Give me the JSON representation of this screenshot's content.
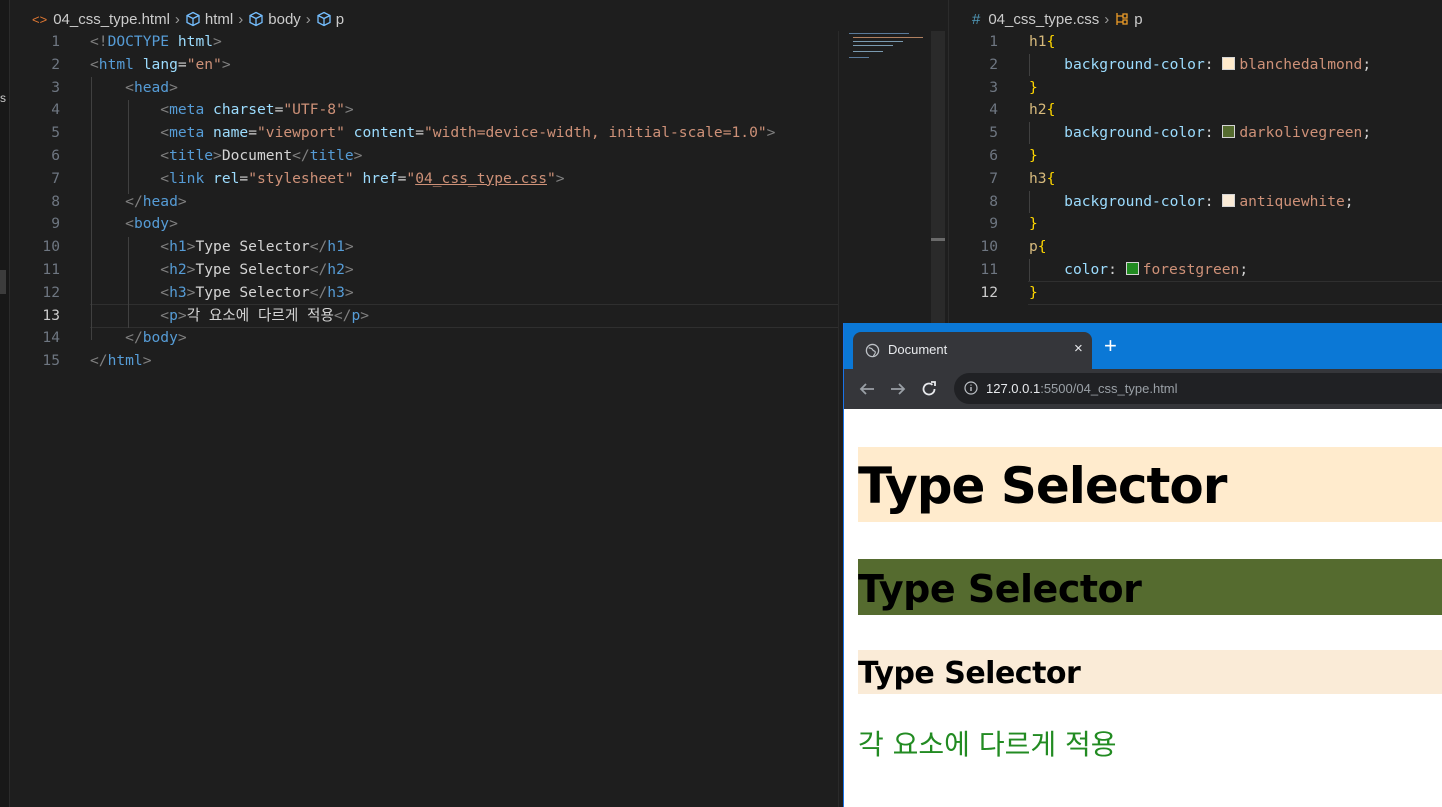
{
  "html_editor": {
    "breadcrumb": {
      "file": "04_css_type.html",
      "html": "html",
      "body": "body",
      "p": "p"
    },
    "lines": [
      {
        "n": "1",
        "segs": [
          [
            "t-br",
            "<!"
          ],
          [
            "t-tag",
            "DOCTYPE"
          ],
          [
            "t-txt",
            " "
          ],
          [
            "t-attr",
            "html"
          ],
          [
            "t-br",
            ">"
          ]
        ]
      },
      {
        "n": "2",
        "segs": [
          [
            "t-br",
            "<"
          ],
          [
            "t-tag",
            "html"
          ],
          [
            "t-txt",
            " "
          ],
          [
            "t-attr",
            "lang"
          ],
          [
            "t-txt",
            "="
          ],
          [
            "t-str",
            "\"en\""
          ],
          [
            "t-br",
            ">"
          ]
        ]
      },
      {
        "n": "3",
        "segs": [
          [
            "t-txt",
            "    "
          ],
          [
            "t-br",
            "<"
          ],
          [
            "t-tag",
            "head"
          ],
          [
            "t-br",
            ">"
          ]
        ]
      },
      {
        "n": "4",
        "segs": [
          [
            "t-txt",
            "        "
          ],
          [
            "t-br",
            "<"
          ],
          [
            "t-tag",
            "meta"
          ],
          [
            "t-txt",
            " "
          ],
          [
            "t-attr",
            "charset"
          ],
          [
            "t-txt",
            "="
          ],
          [
            "t-str",
            "\"UTF-8\""
          ],
          [
            "t-br",
            ">"
          ]
        ]
      },
      {
        "n": "5",
        "segs": [
          [
            "t-txt",
            "        "
          ],
          [
            "t-br",
            "<"
          ],
          [
            "t-tag",
            "meta"
          ],
          [
            "t-txt",
            " "
          ],
          [
            "t-attr",
            "name"
          ],
          [
            "t-txt",
            "="
          ],
          [
            "t-str",
            "\"viewport\""
          ],
          [
            "t-txt",
            " "
          ],
          [
            "t-attr",
            "content"
          ],
          [
            "t-txt",
            "="
          ],
          [
            "t-str",
            "\"width=device-width, initial-scale=1.0\""
          ],
          [
            "t-br",
            ">"
          ]
        ]
      },
      {
        "n": "6",
        "segs": [
          [
            "t-txt",
            "        "
          ],
          [
            "t-br",
            "<"
          ],
          [
            "t-tag",
            "title"
          ],
          [
            "t-br",
            ">"
          ],
          [
            "t-txt",
            "Document"
          ],
          [
            "t-br",
            "</"
          ],
          [
            "t-tag",
            "title"
          ],
          [
            "t-br",
            ">"
          ]
        ]
      },
      {
        "n": "7",
        "segs": [
          [
            "t-txt",
            "        "
          ],
          [
            "t-br",
            "<"
          ],
          [
            "t-tag",
            "link"
          ],
          [
            "t-txt",
            " "
          ],
          [
            "t-attr",
            "rel"
          ],
          [
            "t-txt",
            "="
          ],
          [
            "t-str",
            "\"stylesheet\""
          ],
          [
            "t-txt",
            " "
          ],
          [
            "t-attr",
            "href"
          ],
          [
            "t-txt",
            "="
          ],
          [
            "t-str",
            "\""
          ],
          [
            "t-str u",
            "04_css_type.css"
          ],
          [
            "t-str",
            "\""
          ],
          [
            "t-br",
            ">"
          ]
        ]
      },
      {
        "n": "8",
        "segs": [
          [
            "t-txt",
            "    "
          ],
          [
            "t-br",
            "</"
          ],
          [
            "t-tag",
            "head"
          ],
          [
            "t-br",
            ">"
          ]
        ]
      },
      {
        "n": "9",
        "segs": [
          [
            "t-txt",
            "    "
          ],
          [
            "t-br",
            "<"
          ],
          [
            "t-tag",
            "body"
          ],
          [
            "t-br",
            ">"
          ]
        ]
      },
      {
        "n": "10",
        "segs": [
          [
            "t-txt",
            "        "
          ],
          [
            "t-br",
            "<"
          ],
          [
            "t-tag",
            "h1"
          ],
          [
            "t-br",
            ">"
          ],
          [
            "t-txt",
            "Type Selector"
          ],
          [
            "t-br",
            "</"
          ],
          [
            "t-tag",
            "h1"
          ],
          [
            "t-br",
            ">"
          ]
        ]
      },
      {
        "n": "11",
        "segs": [
          [
            "t-txt",
            "        "
          ],
          [
            "t-br",
            "<"
          ],
          [
            "t-tag",
            "h2"
          ],
          [
            "t-br",
            ">"
          ],
          [
            "t-txt",
            "Type Selector"
          ],
          [
            "t-br",
            "</"
          ],
          [
            "t-tag",
            "h2"
          ],
          [
            "t-br",
            ">"
          ]
        ]
      },
      {
        "n": "12",
        "segs": [
          [
            "t-txt",
            "        "
          ],
          [
            "t-br",
            "<"
          ],
          [
            "t-tag",
            "h3"
          ],
          [
            "t-br",
            ">"
          ],
          [
            "t-txt",
            "Type Selector"
          ],
          [
            "t-br",
            "</"
          ],
          [
            "t-tag",
            "h3"
          ],
          [
            "t-br",
            ">"
          ]
        ]
      },
      {
        "n": "13",
        "segs": [
          [
            "t-txt",
            "        "
          ],
          [
            "t-br",
            "<"
          ],
          [
            "t-tag",
            "p"
          ],
          [
            "t-br",
            ">"
          ],
          [
            "t-txt",
            "각 요소에 다르게 적용"
          ],
          [
            "t-br",
            "</"
          ],
          [
            "t-tag",
            "p"
          ],
          [
            "t-br",
            ">"
          ]
        ]
      },
      {
        "n": "14",
        "segs": [
          [
            "t-txt",
            "    "
          ],
          [
            "t-br",
            "</"
          ],
          [
            "t-tag",
            "body"
          ],
          [
            "t-br",
            ">"
          ]
        ]
      },
      {
        "n": "15",
        "segs": [
          [
            "t-br",
            "</"
          ],
          [
            "t-tag",
            "html"
          ],
          [
            "t-br",
            ">"
          ]
        ]
      }
    ]
  },
  "css_editor": {
    "breadcrumb": {
      "file": "04_css_type.css",
      "p": "p"
    },
    "lines": [
      {
        "n": "1",
        "segs": [
          [
            "t-sel",
            "h1"
          ],
          [
            "t-brace",
            "{"
          ]
        ]
      },
      {
        "n": "2",
        "swatch": "#ffebcd",
        "segs": [
          [
            "t-txt",
            "    "
          ],
          [
            "t-prop",
            "background-color"
          ],
          [
            "t-punc",
            ": "
          ],
          [
            "sw",
            ""
          ],
          [
            "t-val",
            "blanchedalmond"
          ],
          [
            "t-punc",
            ";"
          ]
        ]
      },
      {
        "n": "3",
        "segs": [
          [
            "t-brace",
            "}"
          ]
        ]
      },
      {
        "n": "4",
        "segs": [
          [
            "t-sel",
            "h2"
          ],
          [
            "t-brace",
            "{"
          ]
        ]
      },
      {
        "n": "5",
        "swatch": "#556b2f",
        "segs": [
          [
            "t-txt",
            "    "
          ],
          [
            "t-prop",
            "background-color"
          ],
          [
            "t-punc",
            ": "
          ],
          [
            "sw",
            ""
          ],
          [
            "t-val",
            "darkolivegreen"
          ],
          [
            "t-punc",
            ";"
          ]
        ]
      },
      {
        "n": "6",
        "segs": [
          [
            "t-brace",
            "}"
          ]
        ]
      },
      {
        "n": "7",
        "segs": [
          [
            "t-sel",
            "h3"
          ],
          [
            "t-brace",
            "{"
          ]
        ]
      },
      {
        "n": "8",
        "swatch": "#faebd7",
        "segs": [
          [
            "t-txt",
            "    "
          ],
          [
            "t-prop",
            "background-color"
          ],
          [
            "t-punc",
            ": "
          ],
          [
            "sw",
            ""
          ],
          [
            "t-val",
            "antiquewhite"
          ],
          [
            "t-punc",
            ";"
          ]
        ]
      },
      {
        "n": "9",
        "segs": [
          [
            "t-brace",
            "}"
          ]
        ]
      },
      {
        "n": "10",
        "segs": [
          [
            "t-sel",
            "p"
          ],
          [
            "t-brace",
            "{"
          ]
        ]
      },
      {
        "n": "11",
        "swatch": "#228b22",
        "segs": [
          [
            "t-txt",
            "    "
          ],
          [
            "t-prop",
            "color"
          ],
          [
            "t-punc",
            ": "
          ],
          [
            "sw",
            ""
          ],
          [
            "t-val",
            "forestgreen"
          ],
          [
            "t-punc",
            ";"
          ]
        ]
      },
      {
        "n": "12",
        "segs": [
          [
            "t-brace",
            "}"
          ]
        ]
      }
    ]
  },
  "browser": {
    "tab_title": "Document",
    "close": "×",
    "new_tab": "+",
    "url_host": "127.0.0.1",
    "url_path": ":5500/04_css_type.html",
    "h1": "Type Selector",
    "h2": "Type Selector",
    "h3": "Type Selector",
    "p": "각 요소에 다르게 적용"
  },
  "activity_label": "s"
}
